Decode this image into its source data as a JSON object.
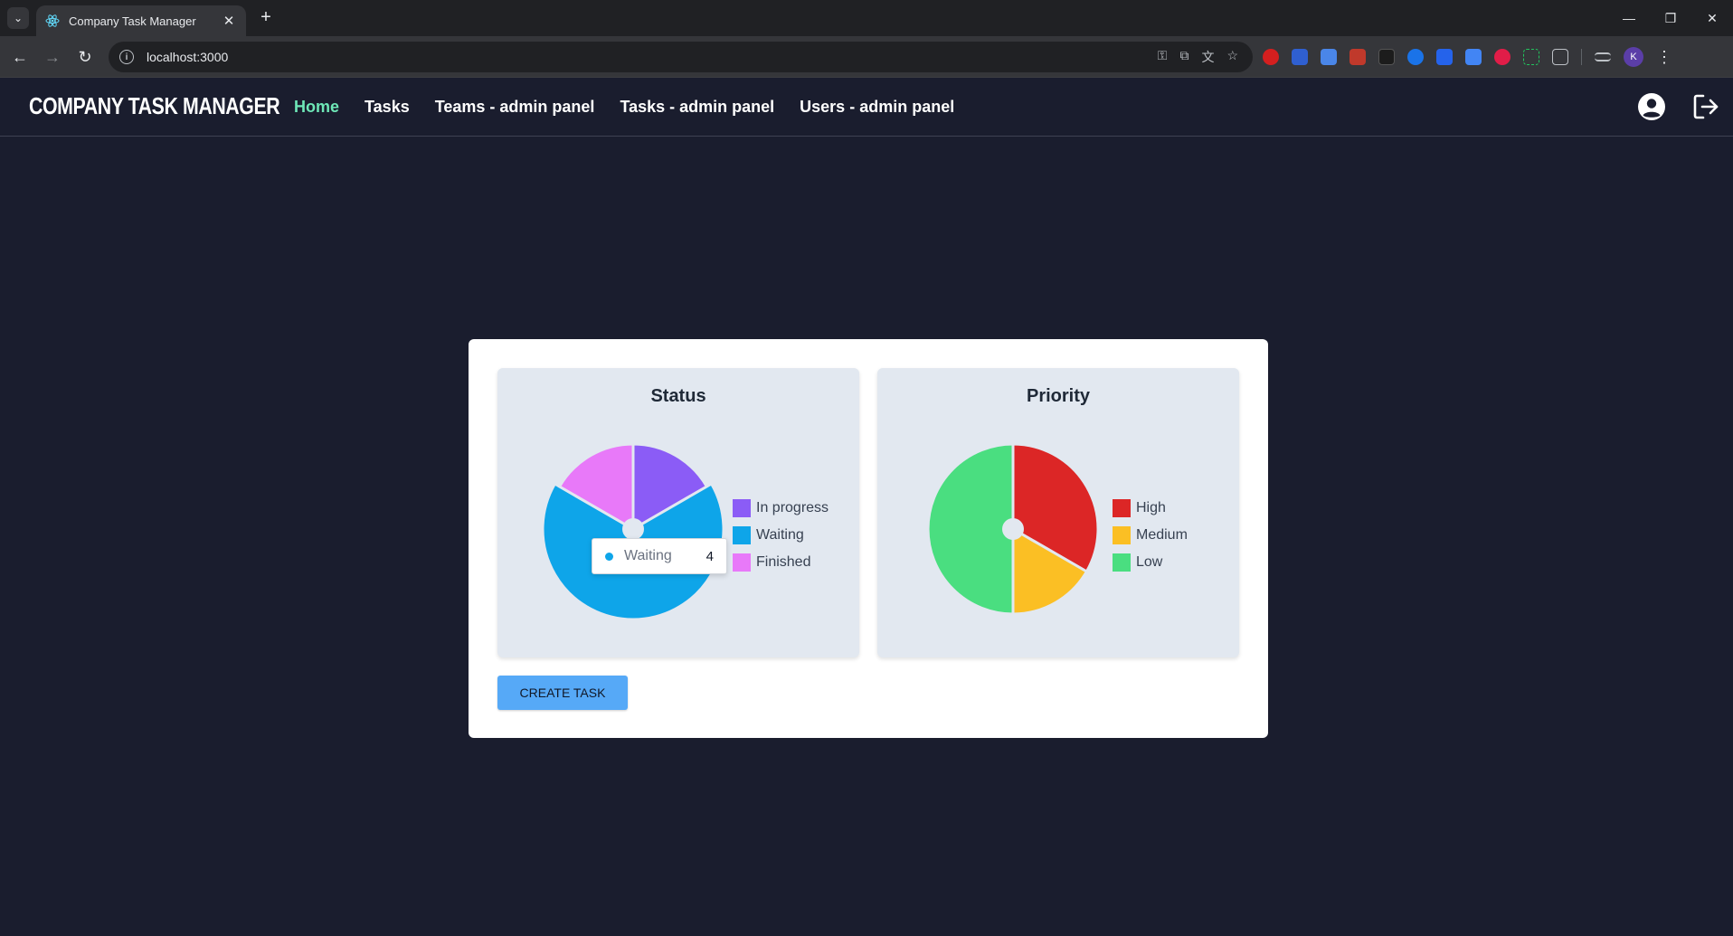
{
  "browser": {
    "tab_title": "Company Task Manager",
    "url": "localhost:3000",
    "profile_initial": "K"
  },
  "nav": {
    "brand": "COMPANY TASK MANAGER",
    "links": [
      {
        "label": "Home",
        "active": true
      },
      {
        "label": "Tasks",
        "active": false
      },
      {
        "label": "Teams - admin panel",
        "active": false
      },
      {
        "label": "Tasks - admin panel",
        "active": false
      },
      {
        "label": "Users - admin panel",
        "active": false
      }
    ]
  },
  "dashboard": {
    "create_button": "CREATE TASK"
  },
  "chart_data": [
    {
      "type": "pie",
      "title": "Status",
      "categories": [
        "In progress",
        "Waiting",
        "Finished"
      ],
      "values": [
        1,
        4,
        1
      ],
      "colors": [
        "#8b5cf6",
        "#0ea5e9",
        "#e879f9"
      ],
      "legend": "right",
      "tooltip": {
        "label": "Waiting",
        "value": "4",
        "color": "#0ea5e9"
      }
    },
    {
      "type": "pie",
      "title": "Priority",
      "categories": [
        "High",
        "Medium",
        "Low"
      ],
      "values": [
        2,
        1,
        3
      ],
      "colors": [
        "#dc2626",
        "#fbbf24",
        "#4ade80"
      ],
      "legend": "right"
    }
  ]
}
